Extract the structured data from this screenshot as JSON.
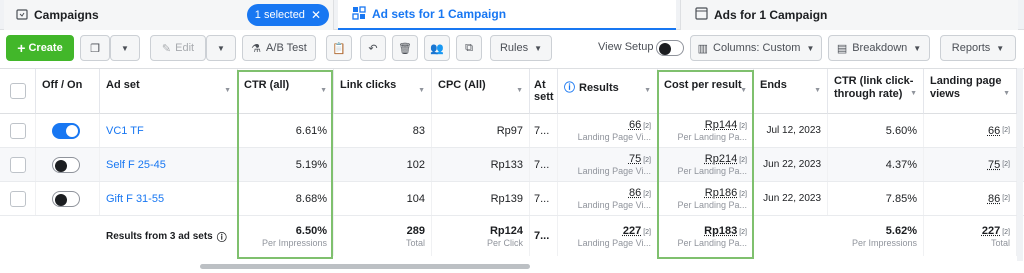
{
  "tabs": {
    "campaigns": "Campaigns",
    "selected_pill": "1 selected",
    "adsets": "Ad sets for 1 Campaign",
    "ads": "Ads for 1 Campaign"
  },
  "toolbar": {
    "create": "Create",
    "edit": "Edit",
    "ab_test": "A/B Test",
    "rules": "Rules",
    "view_setup": "View Setup",
    "columns": "Columns: Custom",
    "breakdown": "Breakdown",
    "reports": "Reports"
  },
  "columns": {
    "onoff": "Off / On",
    "adset": "Ad set",
    "ctr": "CTR (all)",
    "link_clicks": "Link clicks",
    "cpc": "CPC (All)",
    "attr": "At sett",
    "results": "Results",
    "cost": "Cost per result",
    "ends": "Ends",
    "ctr_link": "CTR (link click-through rate)",
    "lpv": "Landing page views"
  },
  "rows": [
    {
      "on": true,
      "name": "VC1 TF",
      "ctr": "6.61%",
      "clicks": "83",
      "cpc": "Rp97",
      "attr": "7...",
      "results": "66",
      "results_sub": "Landing Page Vi...",
      "cost": "Rp144",
      "cost_sub": "Per Landing Pa...",
      "ends": "Jul 12, 2023",
      "ctr_link": "5.60%",
      "lpv": "66"
    },
    {
      "on": false,
      "name": "Self F 25-45",
      "ctr": "5.19%",
      "clicks": "102",
      "cpc": "Rp133",
      "attr": "7...",
      "results": "75",
      "results_sub": "Landing Page Vi...",
      "cost": "Rp214",
      "cost_sub": "Per Landing Pa...",
      "ends": "Jun 22, 2023",
      "ctr_link": "4.37%",
      "lpv": "75"
    },
    {
      "on": false,
      "name": "Gift F 31-55",
      "ctr": "8.68%",
      "clicks": "104",
      "cpc": "Rp139",
      "attr": "7...",
      "results": "86",
      "results_sub": "Landing Page Vi...",
      "cost": "Rp186",
      "cost_sub": "Per Landing Pa...",
      "ends": "Jun 22, 2023",
      "ctr_link": "7.85%",
      "lpv": "86"
    }
  ],
  "totals": {
    "label": "Results from 3 ad sets",
    "ctr": "6.50%",
    "ctr_sub": "Per Impressions",
    "clicks": "289",
    "clicks_sub": "Total",
    "cpc": "Rp124",
    "cpc_sub": "Per Click",
    "attr": "7...",
    "results": "227",
    "results_sub": "Landing Page Vi...",
    "cost": "Rp183",
    "cost_sub": "Per Landing Pa...",
    "ctr_link": "5.62%",
    "ctr_link_sub": "Per Impressions",
    "lpv": "227",
    "lpv_sub": "Total"
  },
  "icons": {
    "sup_mark": "[2]"
  },
  "colors": {
    "accent": "#1877f2",
    "create": "#42b72a",
    "highlight": "#7fc06e"
  }
}
